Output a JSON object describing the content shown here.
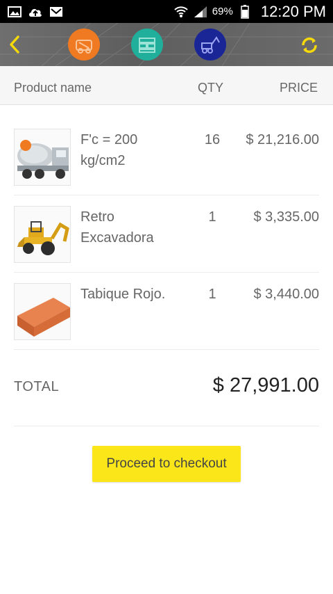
{
  "status_bar": {
    "battery": "69%",
    "time": "12:20 PM"
  },
  "toolbar": {
    "category_icons": [
      "concrete-category-icon",
      "blocks-category-icon",
      "machinery-category-icon"
    ],
    "colors": {
      "category_1": "#f07a22",
      "category_2": "#1faf9b",
      "category_3": "#1a2596",
      "accent": "#fbe61a"
    }
  },
  "table": {
    "headers": {
      "name": "Product name",
      "qty": "QTY",
      "price": "PRICE"
    },
    "rows": [
      {
        "name": "F'c = 200 kg/cm2",
        "qty": "16",
        "price": "$ 21,216.00",
        "image": "concrete-mixer-truck"
      },
      {
        "name": "Retro Excavadora",
        "qty": "1",
        "price": "$ 3,335.00",
        "image": "backhoe-loader"
      },
      {
        "name": "Tabique Rojo.",
        "qty": "1",
        "price": "$ 3,440.00",
        "image": "red-brick"
      }
    ]
  },
  "total": {
    "label": "TOTAL",
    "value": "$ 27,991.00"
  },
  "checkout": {
    "label": "Proceed to checkout"
  }
}
